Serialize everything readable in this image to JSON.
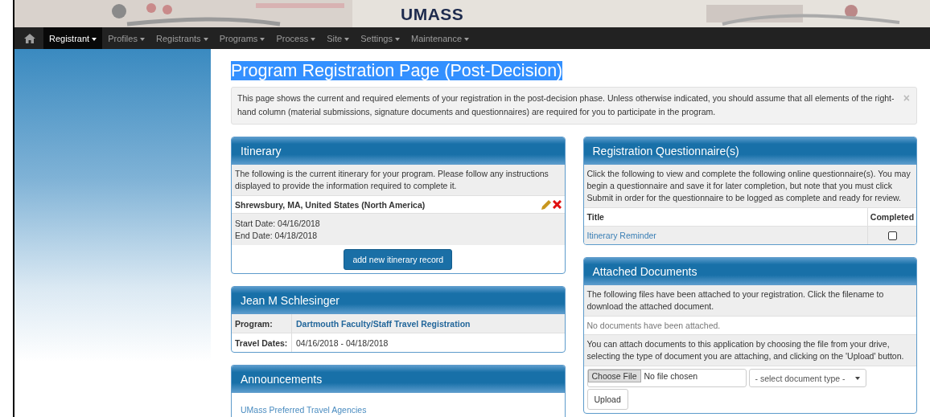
{
  "header": {
    "logo": "UMASS"
  },
  "nav": [
    {
      "label": "Registrant",
      "selected": true
    },
    {
      "label": "Profiles",
      "selected": false
    },
    {
      "label": "Registrants",
      "selected": false
    },
    {
      "label": "Programs",
      "selected": false
    },
    {
      "label": "Process",
      "selected": false
    },
    {
      "label": "Site",
      "selected": false
    },
    {
      "label": "Settings",
      "selected": false
    },
    {
      "label": "Maintenance",
      "selected": false
    }
  ],
  "page_title": "Program Registration Page (Post-Decision)",
  "alert": {
    "text": "This page shows the current and required elements of your registration in the post-decision phase. Unless otherwise indicated, you should assume that all elements of the right-hand column (material submissions, signature documents and questionnaires) are required for you to participate in the program.",
    "close": "×"
  },
  "itinerary": {
    "title": "Itinerary",
    "intro": "The following is the current itinerary for your program. Please follow any instructions displayed to provide the information required to complete it.",
    "records": [
      {
        "location": "Shrewsbury, MA, United States (North America)",
        "start": "Start Date: 04/16/2018",
        "end": "End Date: 04/18/2018"
      }
    ],
    "button": "add new itinerary record"
  },
  "person": {
    "name": "Jean M Schlesinger",
    "rows": [
      {
        "label": "Program:",
        "value": "Dartmouth Faculty/Staff Travel Registration",
        "kind": "link"
      },
      {
        "label": "Travel Dates:",
        "value": "04/16/2018 - 04/18/2018",
        "kind": "text"
      }
    ]
  },
  "announcements": {
    "title": "Announcements",
    "items": [
      "UMass Preferred Travel Agencies"
    ]
  },
  "questionnaires": {
    "title": "Registration Questionnaire(s)",
    "intro": "Click the following to view and complete the following online questionnaire(s). You may begin a questionnaire and save it for later completion, but note that you must click Submit in order for the questionnaire to be logged as complete and ready for review.",
    "columns": [
      "Title",
      "Completed"
    ],
    "rows": [
      {
        "title": "Itinerary Reminder",
        "completed": false
      }
    ]
  },
  "documents": {
    "title": "Attached Documents",
    "intro": "The following files have been attached to your registration. Click the filename to download the attached document.",
    "empty": "No documents have been attached.",
    "help": "You can attach documents to this application by choosing the file from your drive, selecting the type of document you are attaching, and clicking on the 'Upload' button.",
    "choose_button": "Choose File",
    "file_status": "No file chosen",
    "type_select": "- select document type -",
    "upload_button": "Upload"
  }
}
